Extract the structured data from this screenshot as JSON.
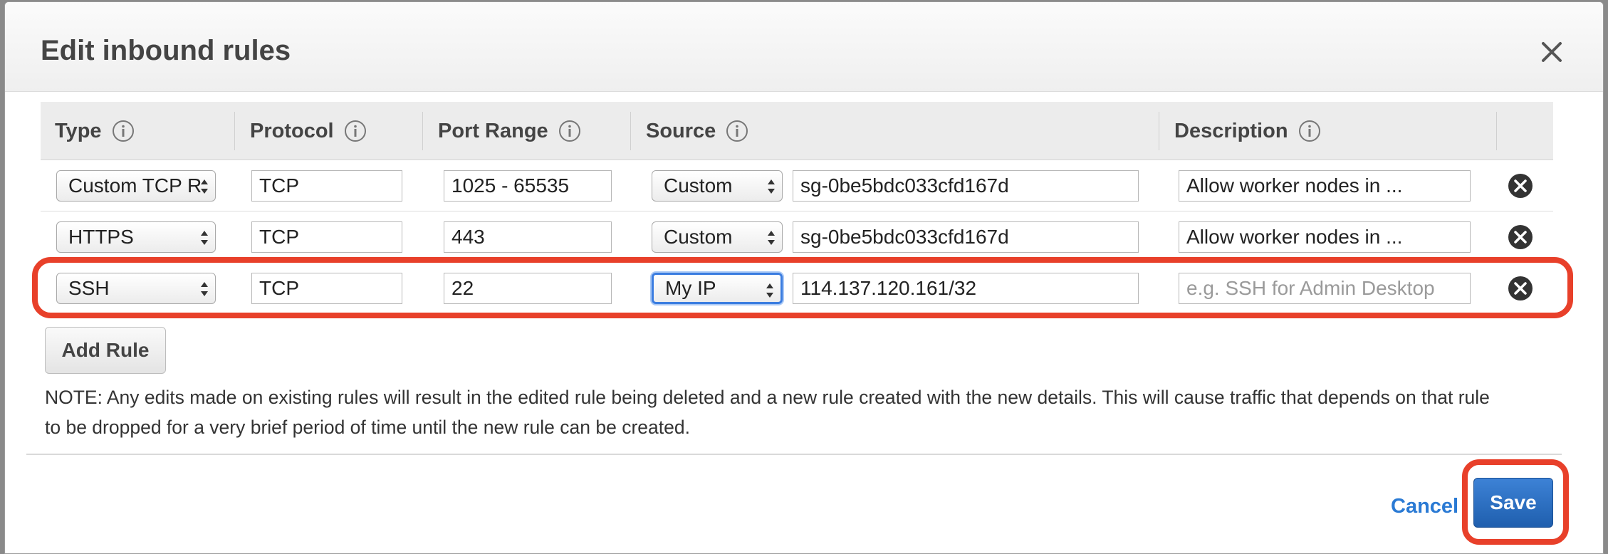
{
  "dialog": {
    "title": "Edit inbound rules",
    "close_icon": "close-icon"
  },
  "table": {
    "headers": [
      "Type",
      "Protocol",
      "Port Range",
      "Source",
      "Description"
    ],
    "rows": [
      {
        "type": "Custom TCP R",
        "protocol": "TCP",
        "port_range": "1025 - 65535",
        "source_type": "Custom",
        "source_value": "sg-0be5bdc033cfd167d",
        "description": "Allow worker nodes in ...",
        "description_placeholder": ""
      },
      {
        "type": "HTTPS",
        "protocol": "TCP",
        "port_range": "443",
        "source_type": "Custom",
        "source_value": "sg-0be5bdc033cfd167d",
        "description": "Allow worker nodes in ...",
        "description_placeholder": ""
      },
      {
        "type": "SSH",
        "protocol": "TCP",
        "port_range": "22",
        "source_type": "My IP",
        "source_value": "114.137.120.161/32",
        "description": "",
        "description_placeholder": "e.g. SSH for Admin Desktop"
      }
    ]
  },
  "buttons": {
    "add_rule": "Add Rule",
    "cancel": "Cancel",
    "save": "Save"
  },
  "note": "NOTE: Any edits made on existing rules will result in the edited rule being deleted and a new rule created with the new details. This will cause traffic that depends on that rule to be dropped for a very brief period of time until the new rule can be created.",
  "colors": {
    "highlight": "#e8402a",
    "primary": "#2a6fc4",
    "link": "#2a7ad4"
  }
}
